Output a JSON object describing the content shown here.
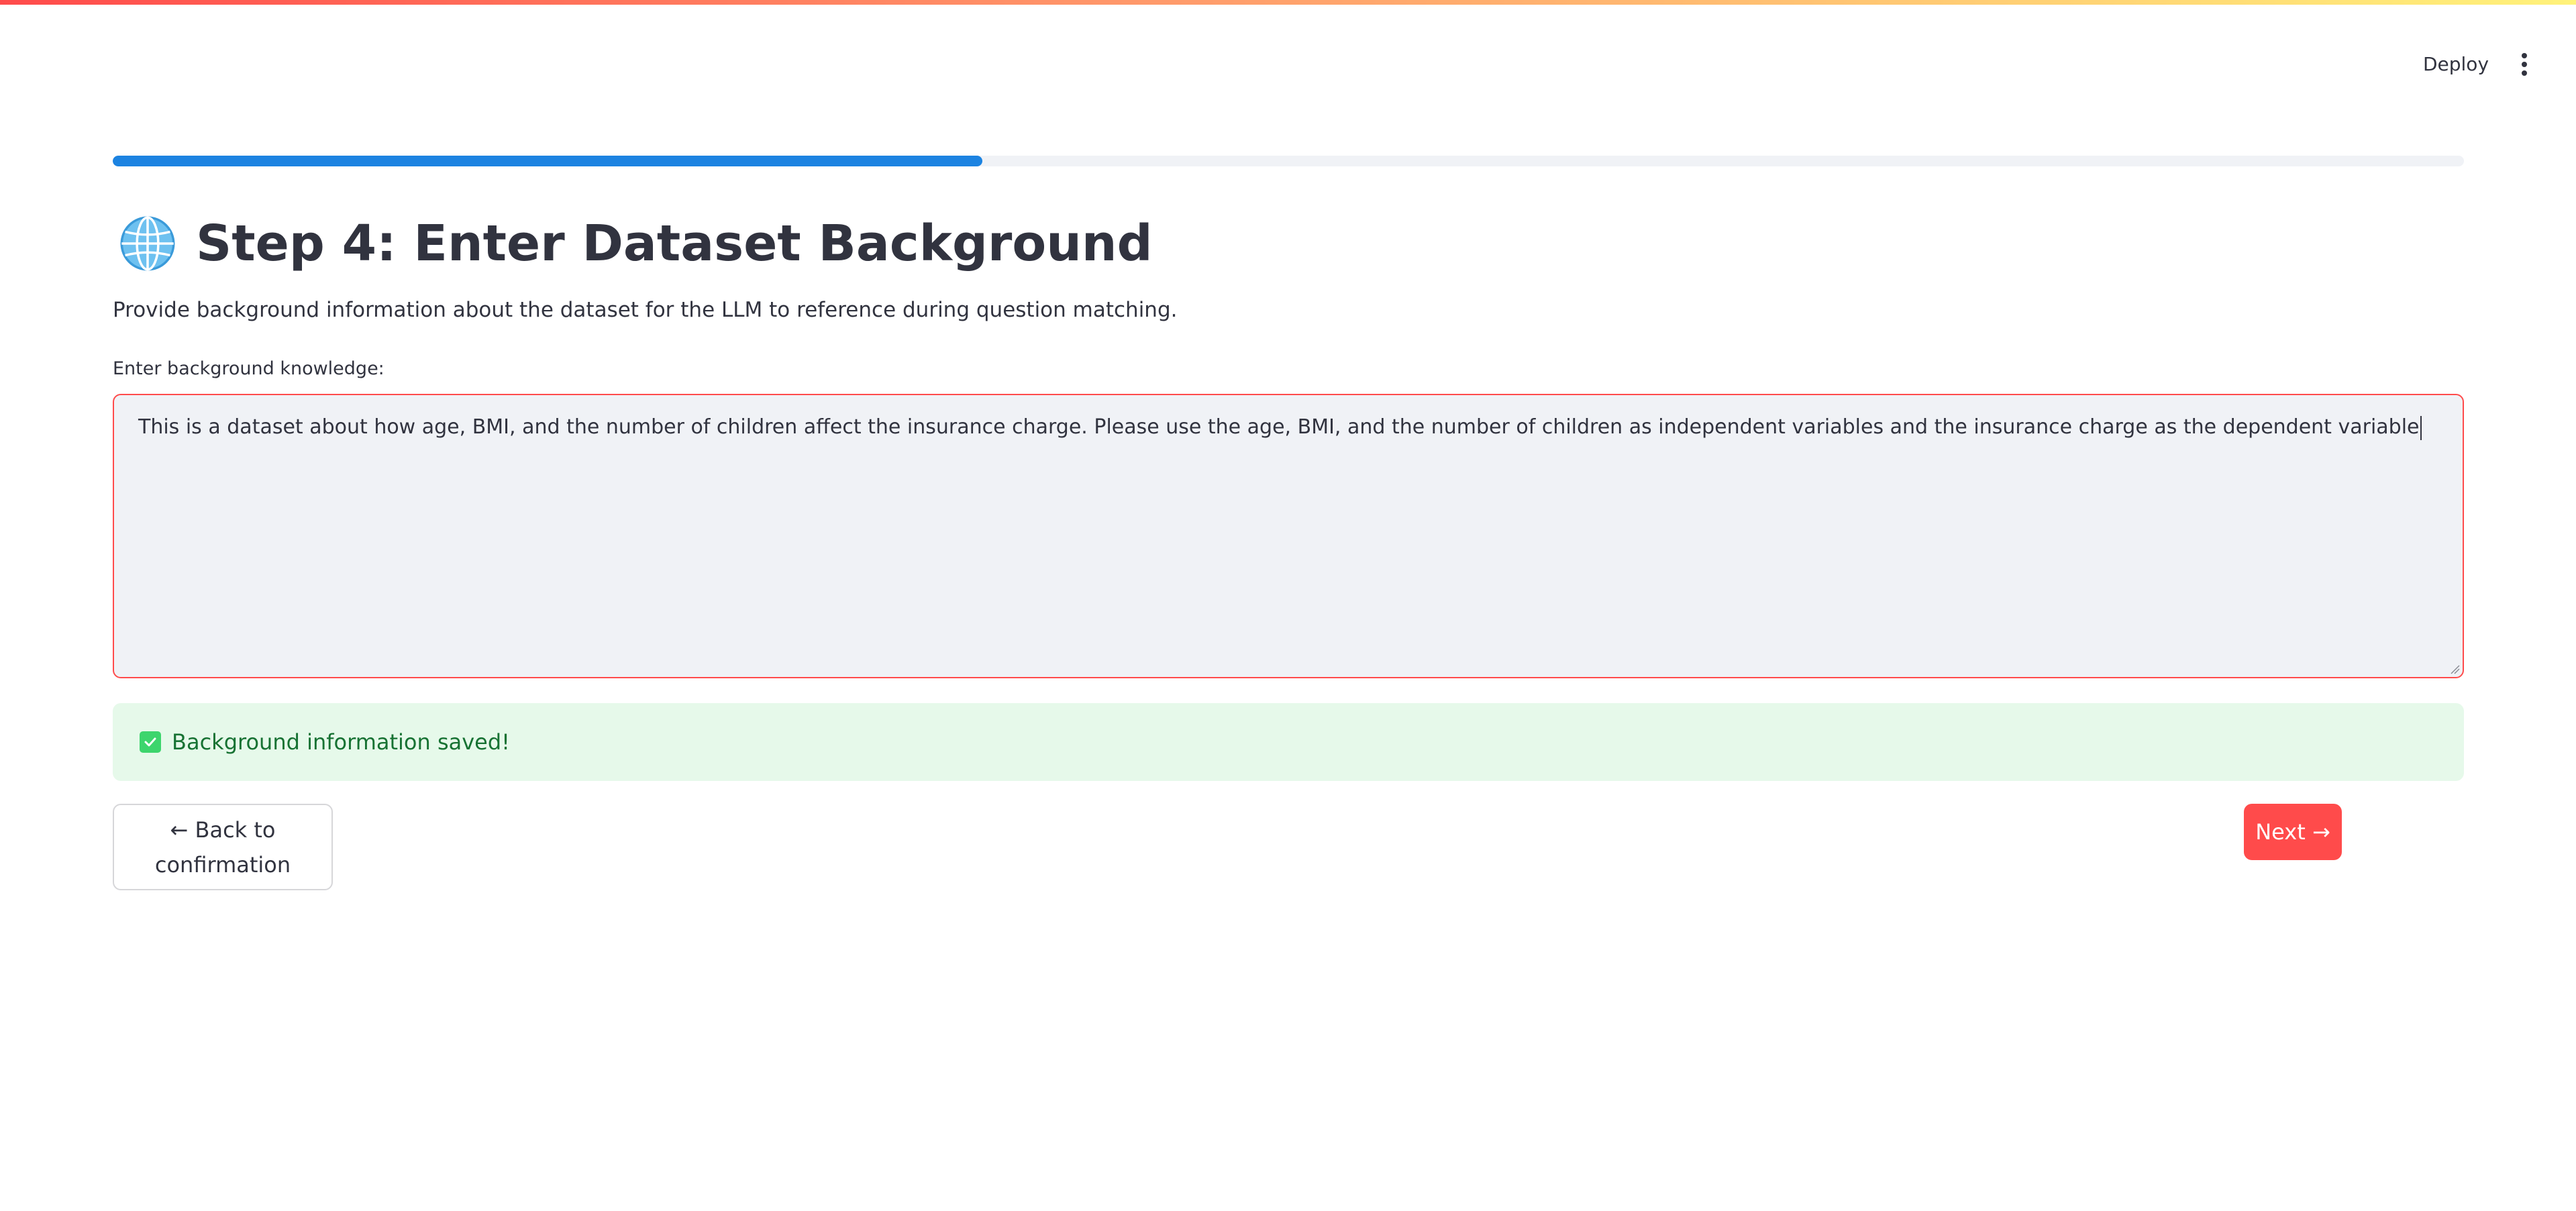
{
  "header": {
    "deploy_label": "Deploy",
    "menu_icon": "vertical-dots-icon"
  },
  "progress": {
    "value": 0.37,
    "color": "#1c83e1"
  },
  "page": {
    "title_icon": "globe-icon",
    "title": "Step 4: Enter Dataset Background",
    "description": "Provide background information about the dataset for the LLM to reference during question matching."
  },
  "background_input": {
    "label": "Enter background knowledge:",
    "value": "This is a dataset about how age, BMI, and the number of children affect the insurance charge. Please use the age, BMI, and the number of children as independent variables and the insurance charge as the dependent variable"
  },
  "status": {
    "icon": "check-box-icon",
    "message": "Background information saved!"
  },
  "navigation": {
    "back_label": "← Back to confirmation",
    "next_label": "Next →"
  },
  "colors": {
    "accent": "#ff4b4b",
    "success_bg": "#e6f9ea",
    "success_text": "#177233"
  }
}
